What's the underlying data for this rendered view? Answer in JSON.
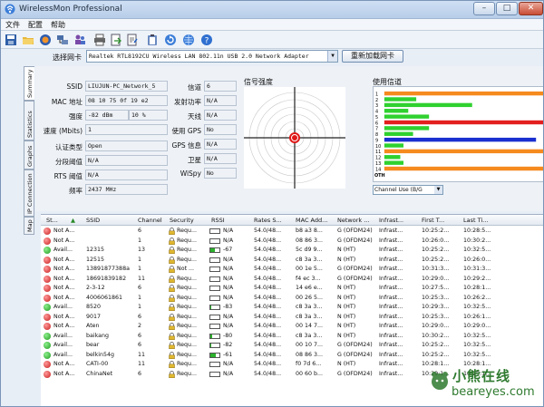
{
  "window": {
    "title": "WirelessMon Professional"
  },
  "menu": [
    "文件",
    "配置",
    "帮助"
  ],
  "toolbar": {
    "icons": [
      "save-icon",
      "open-folder-icon",
      "record-icon",
      "network-icon",
      "users-icon",
      "print-icon",
      "export-icon",
      "settings-icon",
      "clipboard-icon",
      "refresh-icon",
      "globe-icon",
      "help-icon"
    ]
  },
  "adapter": {
    "label": "选择网卡",
    "value": "Realtek RTL8192CU Wireless LAN 802.11n USB 2.0 Network Adapter",
    "reload": "重新加载网卡"
  },
  "tabs": [
    "Summary",
    "Statistics",
    "Graphs",
    "IP Connection",
    "Map"
  ],
  "summary": {
    "ssid_label": "SSID",
    "ssid": "LIUJUN-PC_Network_5",
    "mac_label": "MAC 地址",
    "mac": "08 10 75 0f 19 e2",
    "strength_label": "强度",
    "strength_dbm": "-82 dBm",
    "strength_pct": "10 %",
    "speed_label": "速度 (Mbits)",
    "speed": "1",
    "auth_label": "认证类型",
    "auth": "Open",
    "frag_label": "分段阈值",
    "frag": "N/A",
    "rts_label": "RTS 阈值",
    "rts": "N/A",
    "freq_label": "频率",
    "freq": "2437 MHz",
    "channel_label": "信道",
    "channel": "6",
    "txpower_label": "发射功率",
    "txpower": "N/A",
    "antenna_label": "天线",
    "antenna": "N/A",
    "gps_label": "使用 GPS",
    "gps": "No",
    "gpsinfo_label": "GPS 信息",
    "gpsinfo": "N/A",
    "satellite_label": "卫星",
    "satellite": "N/A",
    "wispy_label": "WiSpy",
    "wispy": "No"
  },
  "radar": {
    "title": "信号强度"
  },
  "channel_usage": {
    "title": "使用信道",
    "select": "Channel Use (B/G",
    "oth": "OTH",
    "rows": [
      {
        "ch": "1",
        "len": 1.0,
        "color": "#f58a1f"
      },
      {
        "ch": "2",
        "len": 0.2,
        "color": "#2fd12f"
      },
      {
        "ch": "3",
        "len": 0.55,
        "color": "#2fd12f"
      },
      {
        "ch": "4",
        "len": 0.15,
        "color": "#2fd12f"
      },
      {
        "ch": "5",
        "len": 0.28,
        "color": "#2fd12f"
      },
      {
        "ch": "6",
        "len": 1.0,
        "color": "#e32020"
      },
      {
        "ch": "7",
        "len": 0.28,
        "color": "#2fd12f"
      },
      {
        "ch": "8",
        "len": 0.18,
        "color": "#2fd12f"
      },
      {
        "ch": "9",
        "len": 0.95,
        "color": "#1a2fd0"
      },
      {
        "ch": "10",
        "len": 0.12,
        "color": "#2fd12f"
      },
      {
        "ch": "11",
        "len": 1.0,
        "color": "#f58a1f"
      },
      {
        "ch": "12",
        "len": 0.1,
        "color": "#2fd12f"
      },
      {
        "ch": "13",
        "len": 0.12,
        "color": "#2fd12f"
      },
      {
        "ch": "14",
        "len": 1.0,
        "color": "#f58a1f"
      }
    ]
  },
  "table": {
    "headers": [
      "St...",
      "",
      "SSID",
      "Channel",
      "Security",
      "RSSI",
      "Rates S...",
      "MAC Add...",
      "Network ...",
      "Infrast...",
      "First T...",
      "Last Ti..."
    ],
    "rows": [
      {
        "st": "Not A...",
        "c": "red",
        "ssid": "",
        "ch": "6",
        "sec": "Requ...",
        "rssi": "N/A",
        "rb": 0,
        "rates": "54.0/48...",
        "mac": "b8 a3 8...",
        "net": "G (OFDM24)",
        "inf": "Infrast...",
        "first": "10:25:2...",
        "last": "10:28:5..."
      },
      {
        "st": "Not A...",
        "c": "red",
        "ssid": "",
        "ch": "1",
        "sec": "Requ...",
        "rssi": "N/A",
        "rb": 0,
        "rates": "54.0/48...",
        "mac": "08 86 3...",
        "net": "G (OFDM24)",
        "inf": "Infrast...",
        "first": "10:26:0...",
        "last": "10:30:2..."
      },
      {
        "st": "Avail...",
        "c": "green",
        "ssid": "12315",
        "ch": "13",
        "sec": "Requ...",
        "rssi": "-67",
        "rb": 0.5,
        "rates": "54.0/48...",
        "mac": "5c d9 9...",
        "net": "N (HT)",
        "inf": "Infrast...",
        "first": "10:25:2...",
        "last": "10:32:5..."
      },
      {
        "st": "Not A...",
        "c": "red",
        "ssid": "12515",
        "ch": "1",
        "sec": "Requ...",
        "rssi": "N/A",
        "rb": 0,
        "rates": "54.0/48...",
        "mac": "c8 3a 3...",
        "net": "N (HT)",
        "inf": "Infrast...",
        "first": "10:25:2...",
        "last": "10:26:0..."
      },
      {
        "st": "Not A...",
        "c": "red",
        "ssid": "13891877388a",
        "ch": "1",
        "sec": "Not ...",
        "rssi": "N/A",
        "rb": 0,
        "rates": "54.0/48...",
        "mac": "00 1e 5...",
        "net": "G (OFDM24)",
        "inf": "Infrast...",
        "first": "10:31:3...",
        "last": "10:31:3..."
      },
      {
        "st": "Not A...",
        "c": "red",
        "ssid": "18691839182",
        "ch": "11",
        "sec": "Requ...",
        "rssi": "N/A",
        "rb": 0,
        "rates": "54.0/48...",
        "mac": "f4 ec 3...",
        "net": "G (OFDM24)",
        "inf": "Infrast...",
        "first": "10:29:0...",
        "last": "10:29:2..."
      },
      {
        "st": "Not A...",
        "c": "red",
        "ssid": "2-3-12",
        "ch": "6",
        "sec": "Requ...",
        "rssi": "N/A",
        "rb": 0,
        "rates": "54.0/48...",
        "mac": "14 e6 e...",
        "net": "N (HT)",
        "inf": "Infrast...",
        "first": "10:27:5...",
        "last": "10:28:1..."
      },
      {
        "st": "Not A...",
        "c": "red",
        "ssid": "4006061861",
        "ch": "1",
        "sec": "Requ...",
        "rssi": "N/A",
        "rb": 0,
        "rates": "54.0/48...",
        "mac": "00 26 5...",
        "net": "N (HT)",
        "inf": "Infrast...",
        "first": "10:25:3...",
        "last": "10:26:2..."
      },
      {
        "st": "Avail...",
        "c": "green",
        "ssid": "8520",
        "ch": "1",
        "sec": "Requ...",
        "rssi": "-83",
        "rb": 0.1,
        "rates": "54.0/48...",
        "mac": "c8 3a 3...",
        "net": "N (HT)",
        "inf": "Infrast...",
        "first": "10:29:3...",
        "last": "10:32:5..."
      },
      {
        "st": "Not A...",
        "c": "red",
        "ssid": "9017",
        "ch": "6",
        "sec": "Requ...",
        "rssi": "N/A",
        "rb": 0,
        "rates": "54.0/48...",
        "mac": "c8 3a 3...",
        "net": "N (HT)",
        "inf": "Infrast...",
        "first": "10:25:3...",
        "last": "10:26:1..."
      },
      {
        "st": "Not A...",
        "c": "red",
        "ssid": "Aten",
        "ch": "2",
        "sec": "Requ...",
        "rssi": "N/A",
        "rb": 0,
        "rates": "54.0/48...",
        "mac": "00 14 7...",
        "net": "N (HT)",
        "inf": "Infrast...",
        "first": "10:29:0...",
        "last": "10:29:0..."
      },
      {
        "st": "Avail...",
        "c": "green",
        "ssid": "baikang",
        "ch": "6",
        "sec": "Requ...",
        "rssi": "-80",
        "rb": 0.15,
        "rates": "54.0/48...",
        "mac": "c8 3a 3...",
        "net": "N (HT)",
        "inf": "Infrast...",
        "first": "10:30:2...",
        "last": "10:32:5..."
      },
      {
        "st": "Avail...",
        "c": "green",
        "ssid": "bear",
        "ch": "6",
        "sec": "Requ...",
        "rssi": "-82",
        "rb": 0.1,
        "rates": "54.0/48...",
        "mac": "00 10 7...",
        "net": "G (OFDM24)",
        "inf": "Infrast...",
        "first": "10:25:2...",
        "last": "10:32:5..."
      },
      {
        "st": "Avail...",
        "c": "green",
        "ssid": "belkin54g",
        "ch": "11",
        "sec": "Requ...",
        "rssi": "-61",
        "rb": 0.6,
        "rates": "54.0/48...",
        "mac": "08 86 3...",
        "net": "G (OFDM24)",
        "inf": "Infrast...",
        "first": "10:25:2...",
        "last": "10:32:5..."
      },
      {
        "st": "Not A...",
        "c": "red",
        "ssid": "CATI-00",
        "ch": "11",
        "sec": "Requ...",
        "rssi": "N/A",
        "rb": 0,
        "rates": "54.0/48...",
        "mac": "f0 7d 6...",
        "net": "N (HT)",
        "inf": "Infrast...",
        "first": "10:28:1...",
        "last": "10:28:1..."
      },
      {
        "st": "Not A...",
        "c": "red",
        "ssid": "ChinaNet",
        "ch": "6",
        "sec": "Requ...",
        "rssi": "N/A",
        "rb": 0,
        "rates": "54.0/48...",
        "mac": "00 60 b...",
        "net": "G (OFDM24)",
        "inf": "Infrast...",
        "first": "10:29:1...",
        "last": "10:29:1..."
      }
    ]
  },
  "watermark": {
    "cn": "小熊在线",
    "en": "beareyes.com"
  }
}
